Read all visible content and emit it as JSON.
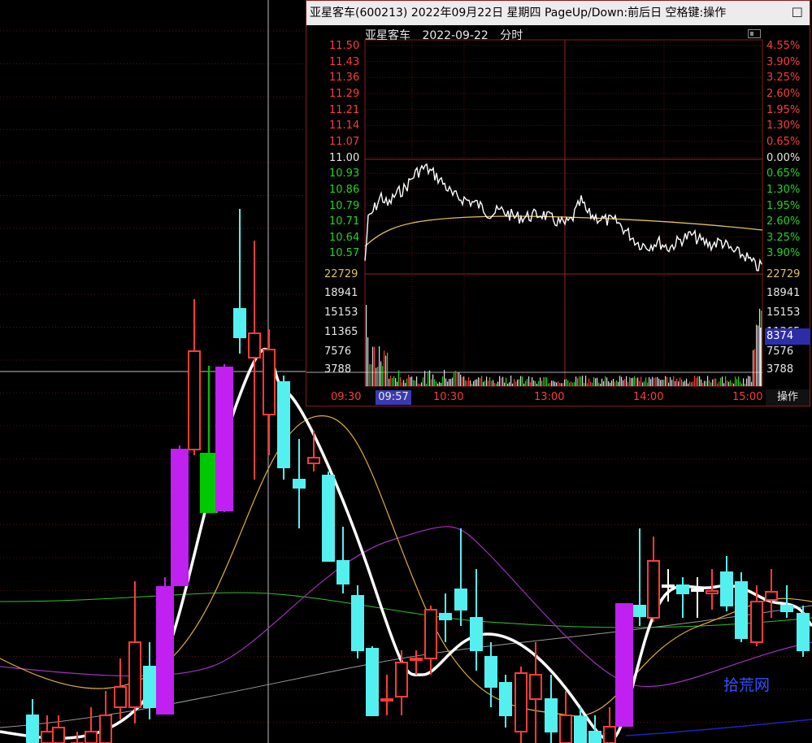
{
  "popup": {
    "title": "亚星客车(600213) 2022年09月22日 星期四 PageUp/Down:前后日 空格键:操作",
    "close_icon": "restore-window-icon",
    "subhead": {
      "name": "亚星客车",
      "date": "2022-09-22",
      "mode": "分时"
    },
    "left_prices": [
      "11.50",
      "11.43",
      "11.36",
      "11.29",
      "11.21",
      "11.14",
      "11.07",
      "11.00",
      "10.93",
      "10.86",
      "10.79",
      "10.71",
      "10.64",
      "10.57"
    ],
    "right_pcts": [
      "4.55%",
      "3.90%",
      "3.25%",
      "2.60%",
      "1.95%",
      "1.30%",
      "0.65%",
      "0.00%",
      "0.65%",
      "1.30%",
      "1.95%",
      "2.60%",
      "3.25%",
      "3.90%"
    ],
    "vol_labels": [
      "22729",
      "18941",
      "15153",
      "11365",
      "7576",
      "3788"
    ],
    "vol_current": "8374",
    "time_labels": [
      "09:30",
      "10:30",
      "13:00",
      "14:00",
      "15:00"
    ],
    "time_cursor": "09:57",
    "op_button": "操作",
    "colors": {
      "up": "#ff3b3b",
      "down": "#21d421",
      "price_line": "#ffffff",
      "avg_line": "#e0c060",
      "grid": "#8a1c1c"
    }
  },
  "watermark": "拾荒网",
  "kline": {
    "colors": {
      "up_candle": "#ff3b3b",
      "down_candle": "#54f0f0",
      "limit_up": "#c020f0",
      "limit_down": "#00c800",
      "ma5": "#ffffff",
      "ma10": "#e0b030",
      "ma20": "#a030c0",
      "ma30": "#30c030",
      "ma60": "#999999",
      "ma120": "#2020c0"
    }
  }
}
